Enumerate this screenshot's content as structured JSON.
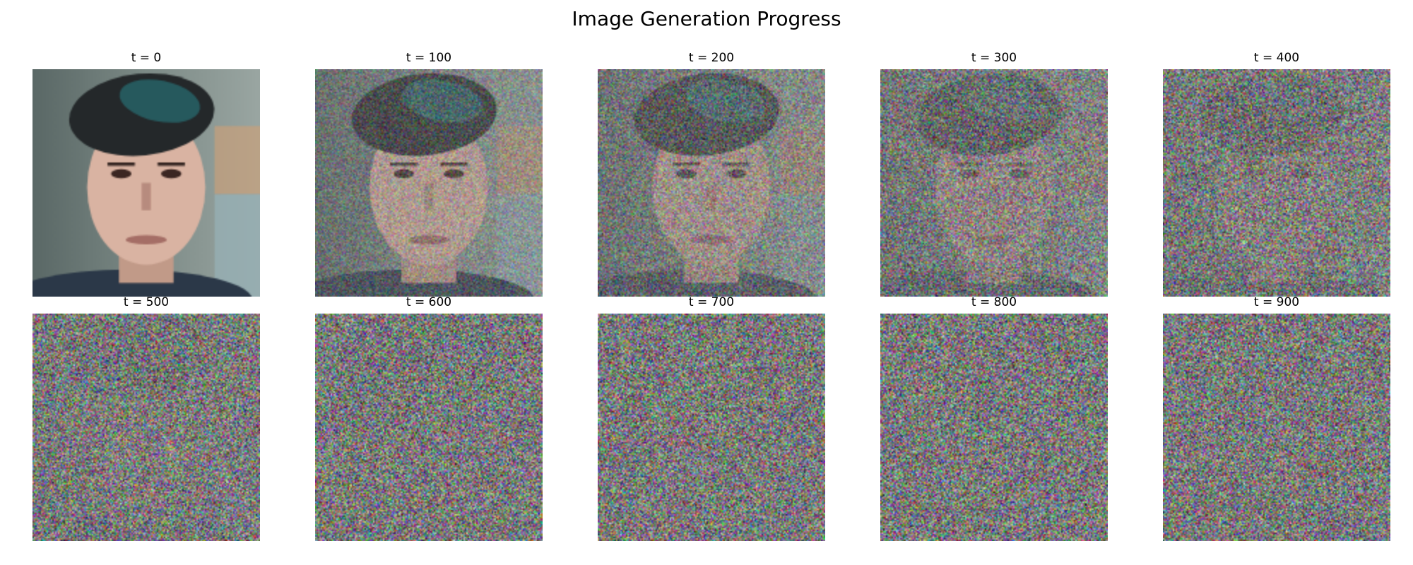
{
  "figure": {
    "title": "Image Generation Progress"
  },
  "panels": [
    {
      "label": "t = 0",
      "noise_level": 0.0
    },
    {
      "label": "t = 100",
      "noise_level": 0.45
    },
    {
      "label": "t = 200",
      "noise_level": 0.62
    },
    {
      "label": "t = 300",
      "noise_level": 0.78
    },
    {
      "label": "t = 400",
      "noise_level": 0.88
    },
    {
      "label": "t = 500",
      "noise_level": 0.95
    },
    {
      "label": "t = 600",
      "noise_level": 0.98
    },
    {
      "label": "t = 700",
      "noise_level": 0.99
    },
    {
      "label": "t = 800",
      "noise_level": 1.0
    },
    {
      "label": "t = 900",
      "noise_level": 1.0
    }
  ],
  "colors": {
    "noise_mean": "#7a7878",
    "background": "#ffffff"
  }
}
